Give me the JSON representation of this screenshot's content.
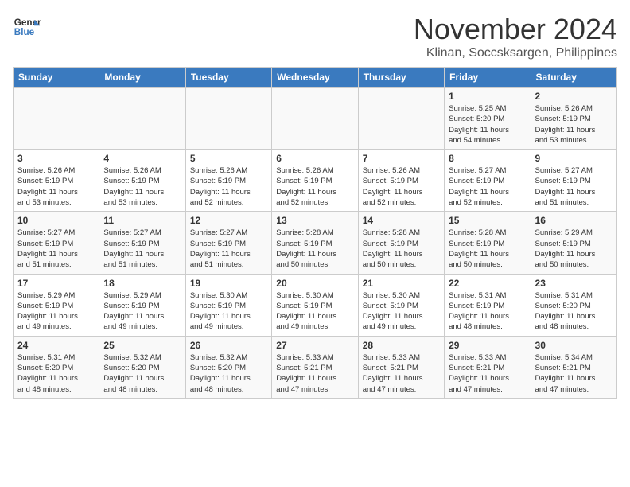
{
  "header": {
    "logo_line1": "General",
    "logo_line2": "Blue",
    "month": "November 2024",
    "location": "Klinan, Soccsksargen, Philippines"
  },
  "weekdays": [
    "Sunday",
    "Monday",
    "Tuesday",
    "Wednesday",
    "Thursday",
    "Friday",
    "Saturday"
  ],
  "weeks": [
    [
      {
        "day": "",
        "info": ""
      },
      {
        "day": "",
        "info": ""
      },
      {
        "day": "",
        "info": ""
      },
      {
        "day": "",
        "info": ""
      },
      {
        "day": "",
        "info": ""
      },
      {
        "day": "1",
        "info": "Sunrise: 5:25 AM\nSunset: 5:20 PM\nDaylight: 11 hours\nand 54 minutes."
      },
      {
        "day": "2",
        "info": "Sunrise: 5:26 AM\nSunset: 5:19 PM\nDaylight: 11 hours\nand 53 minutes."
      }
    ],
    [
      {
        "day": "3",
        "info": "Sunrise: 5:26 AM\nSunset: 5:19 PM\nDaylight: 11 hours\nand 53 minutes."
      },
      {
        "day": "4",
        "info": "Sunrise: 5:26 AM\nSunset: 5:19 PM\nDaylight: 11 hours\nand 53 minutes."
      },
      {
        "day": "5",
        "info": "Sunrise: 5:26 AM\nSunset: 5:19 PM\nDaylight: 11 hours\nand 52 minutes."
      },
      {
        "day": "6",
        "info": "Sunrise: 5:26 AM\nSunset: 5:19 PM\nDaylight: 11 hours\nand 52 minutes."
      },
      {
        "day": "7",
        "info": "Sunrise: 5:26 AM\nSunset: 5:19 PM\nDaylight: 11 hours\nand 52 minutes."
      },
      {
        "day": "8",
        "info": "Sunrise: 5:27 AM\nSunset: 5:19 PM\nDaylight: 11 hours\nand 52 minutes."
      },
      {
        "day": "9",
        "info": "Sunrise: 5:27 AM\nSunset: 5:19 PM\nDaylight: 11 hours\nand 51 minutes."
      }
    ],
    [
      {
        "day": "10",
        "info": "Sunrise: 5:27 AM\nSunset: 5:19 PM\nDaylight: 11 hours\nand 51 minutes."
      },
      {
        "day": "11",
        "info": "Sunrise: 5:27 AM\nSunset: 5:19 PM\nDaylight: 11 hours\nand 51 minutes."
      },
      {
        "day": "12",
        "info": "Sunrise: 5:27 AM\nSunset: 5:19 PM\nDaylight: 11 hours\nand 51 minutes."
      },
      {
        "day": "13",
        "info": "Sunrise: 5:28 AM\nSunset: 5:19 PM\nDaylight: 11 hours\nand 50 minutes."
      },
      {
        "day": "14",
        "info": "Sunrise: 5:28 AM\nSunset: 5:19 PM\nDaylight: 11 hours\nand 50 minutes."
      },
      {
        "day": "15",
        "info": "Sunrise: 5:28 AM\nSunset: 5:19 PM\nDaylight: 11 hours\nand 50 minutes."
      },
      {
        "day": "16",
        "info": "Sunrise: 5:29 AM\nSunset: 5:19 PM\nDaylight: 11 hours\nand 50 minutes."
      }
    ],
    [
      {
        "day": "17",
        "info": "Sunrise: 5:29 AM\nSunset: 5:19 PM\nDaylight: 11 hours\nand 49 minutes."
      },
      {
        "day": "18",
        "info": "Sunrise: 5:29 AM\nSunset: 5:19 PM\nDaylight: 11 hours\nand 49 minutes."
      },
      {
        "day": "19",
        "info": "Sunrise: 5:30 AM\nSunset: 5:19 PM\nDaylight: 11 hours\nand 49 minutes."
      },
      {
        "day": "20",
        "info": "Sunrise: 5:30 AM\nSunset: 5:19 PM\nDaylight: 11 hours\nand 49 minutes."
      },
      {
        "day": "21",
        "info": "Sunrise: 5:30 AM\nSunset: 5:19 PM\nDaylight: 11 hours\nand 49 minutes."
      },
      {
        "day": "22",
        "info": "Sunrise: 5:31 AM\nSunset: 5:19 PM\nDaylight: 11 hours\nand 48 minutes."
      },
      {
        "day": "23",
        "info": "Sunrise: 5:31 AM\nSunset: 5:20 PM\nDaylight: 11 hours\nand 48 minutes."
      }
    ],
    [
      {
        "day": "24",
        "info": "Sunrise: 5:31 AM\nSunset: 5:20 PM\nDaylight: 11 hours\nand 48 minutes."
      },
      {
        "day": "25",
        "info": "Sunrise: 5:32 AM\nSunset: 5:20 PM\nDaylight: 11 hours\nand 48 minutes."
      },
      {
        "day": "26",
        "info": "Sunrise: 5:32 AM\nSunset: 5:20 PM\nDaylight: 11 hours\nand 48 minutes."
      },
      {
        "day": "27",
        "info": "Sunrise: 5:33 AM\nSunset: 5:21 PM\nDaylight: 11 hours\nand 47 minutes."
      },
      {
        "day": "28",
        "info": "Sunrise: 5:33 AM\nSunset: 5:21 PM\nDaylight: 11 hours\nand 47 minutes."
      },
      {
        "day": "29",
        "info": "Sunrise: 5:33 AM\nSunset: 5:21 PM\nDaylight: 11 hours\nand 47 minutes."
      },
      {
        "day": "30",
        "info": "Sunrise: 5:34 AM\nSunset: 5:21 PM\nDaylight: 11 hours\nand 47 minutes."
      }
    ]
  ]
}
